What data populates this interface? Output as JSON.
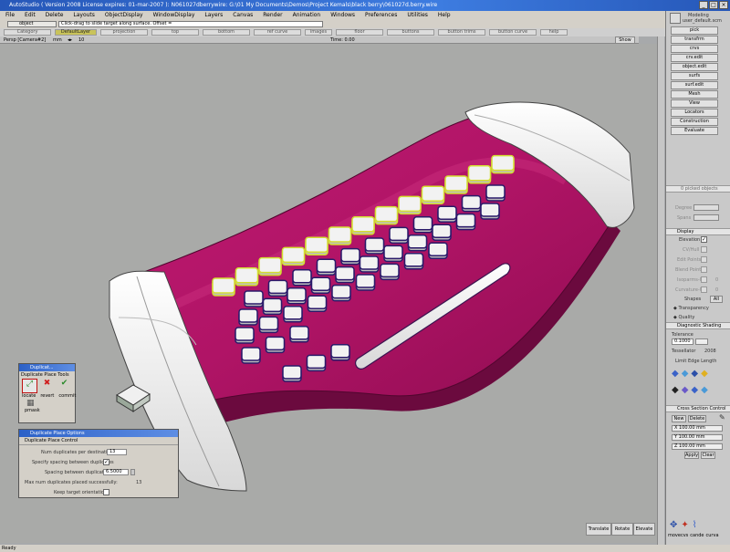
{
  "window": {
    "title": "AutoStudio ( Version 2008  License expires: 01-mar-2007 ): N061027dberrywire: G:\\01 My Documents\\Demos\\Project Kemals\\black berry\\061027d.berry.wire"
  },
  "menu": [
    "File",
    "Edit",
    "Delete",
    "Layouts",
    "ObjectDisplay",
    "WindowDisplay",
    "Layers",
    "Canvas",
    "Render",
    "Animation",
    "Windows",
    "Preferences",
    "Utilities",
    "Help"
  ],
  "toolbar": {
    "pick_mode": "object",
    "hint": "Click-drag to slide target along surface.  Offset ="
  },
  "shelf": {
    "category_label": "Category",
    "active_layer": "DefaultLayer",
    "tabs": [
      "projection",
      "top",
      "bottom",
      "ref curve",
      "images",
      "floor",
      "buttons",
      "button trims",
      "button curve",
      "help"
    ]
  },
  "viewport": {
    "camera": "Persp [Camera#2]",
    "units_label": "mm",
    "units_value": "10",
    "time": "Time: 0.00",
    "show_label": "Show"
  },
  "right_panel": {
    "mode": "Modeling",
    "user": "user_default.scm",
    "palette": [
      "pick",
      "transfrm",
      "crvs",
      "crv.edit",
      "object.edit",
      "surfs",
      "surf.edit",
      "Mesh",
      "View",
      "Locators",
      "Construction",
      "Evaluate"
    ],
    "selection_info": "0 picked objects",
    "degree_label": "Degree",
    "spans_label": "Spans",
    "display_title": "Display",
    "display_options": [
      {
        "label": "Elevation",
        "checked": true
      },
      {
        "label": "CV/Hull",
        "checked": false
      },
      {
        "label": "Edit Points",
        "checked": false
      },
      {
        "label": "Blend Points",
        "checked": false
      },
      {
        "label": "Isoparms-U",
        "checked": false
      },
      {
        "label": "Curvature-U",
        "checked": false
      }
    ],
    "isoparm_value": "0",
    "curvature_value": "0",
    "shapes_label": "Shapes",
    "all_label": "All",
    "transparency_label": "Transparency",
    "quality_label": "Quality",
    "diag_title": "Diagnostic Shading",
    "tolerance_label": "Tolerance",
    "tolerance_value": "0.1000",
    "tessellator_label": "Tessellator",
    "tessellator_value": "2008",
    "limit_edge_label": "Limit Edge Length",
    "cross_title": "Cross Section Control",
    "new_label": "New",
    "delete_label": "Delete",
    "x_value": "X 100.00 mm",
    "y_value": "Y 100.00 mm",
    "z_value": "Z 100.00 mm",
    "apply_label": "Apply",
    "clear_label": "Clear",
    "bottom_tools": [
      "movecvs",
      "cande",
      "curva"
    ]
  },
  "dup_tools": {
    "title": "Duplicat...",
    "subtitle": "Duplicate Place Tools",
    "buttons": [
      "locate",
      "revert",
      "commit"
    ],
    "extra": "pmask"
  },
  "dup_options": {
    "title": "Duplicate Place Options",
    "section": "Duplicate Place Control",
    "num_label": "Num duplicates per destination",
    "num_value": "13",
    "specify_label": "Specify spacing between duplicates",
    "specify_checked": true,
    "spacing_label": "Spacing between duplicates",
    "spacing_value": "6.5000",
    "max_label": "Max num duplicates placed successfully:",
    "max_value": "13",
    "keep_label": "Keep target orientation"
  },
  "manip": {
    "translate": "Translate",
    "rotate": "Rotate",
    "elevate": "Elevate"
  },
  "status": "Ready",
  "colors": {
    "body": "#b01466",
    "accent": "#d4e030",
    "caps": "#f2f2f2"
  }
}
